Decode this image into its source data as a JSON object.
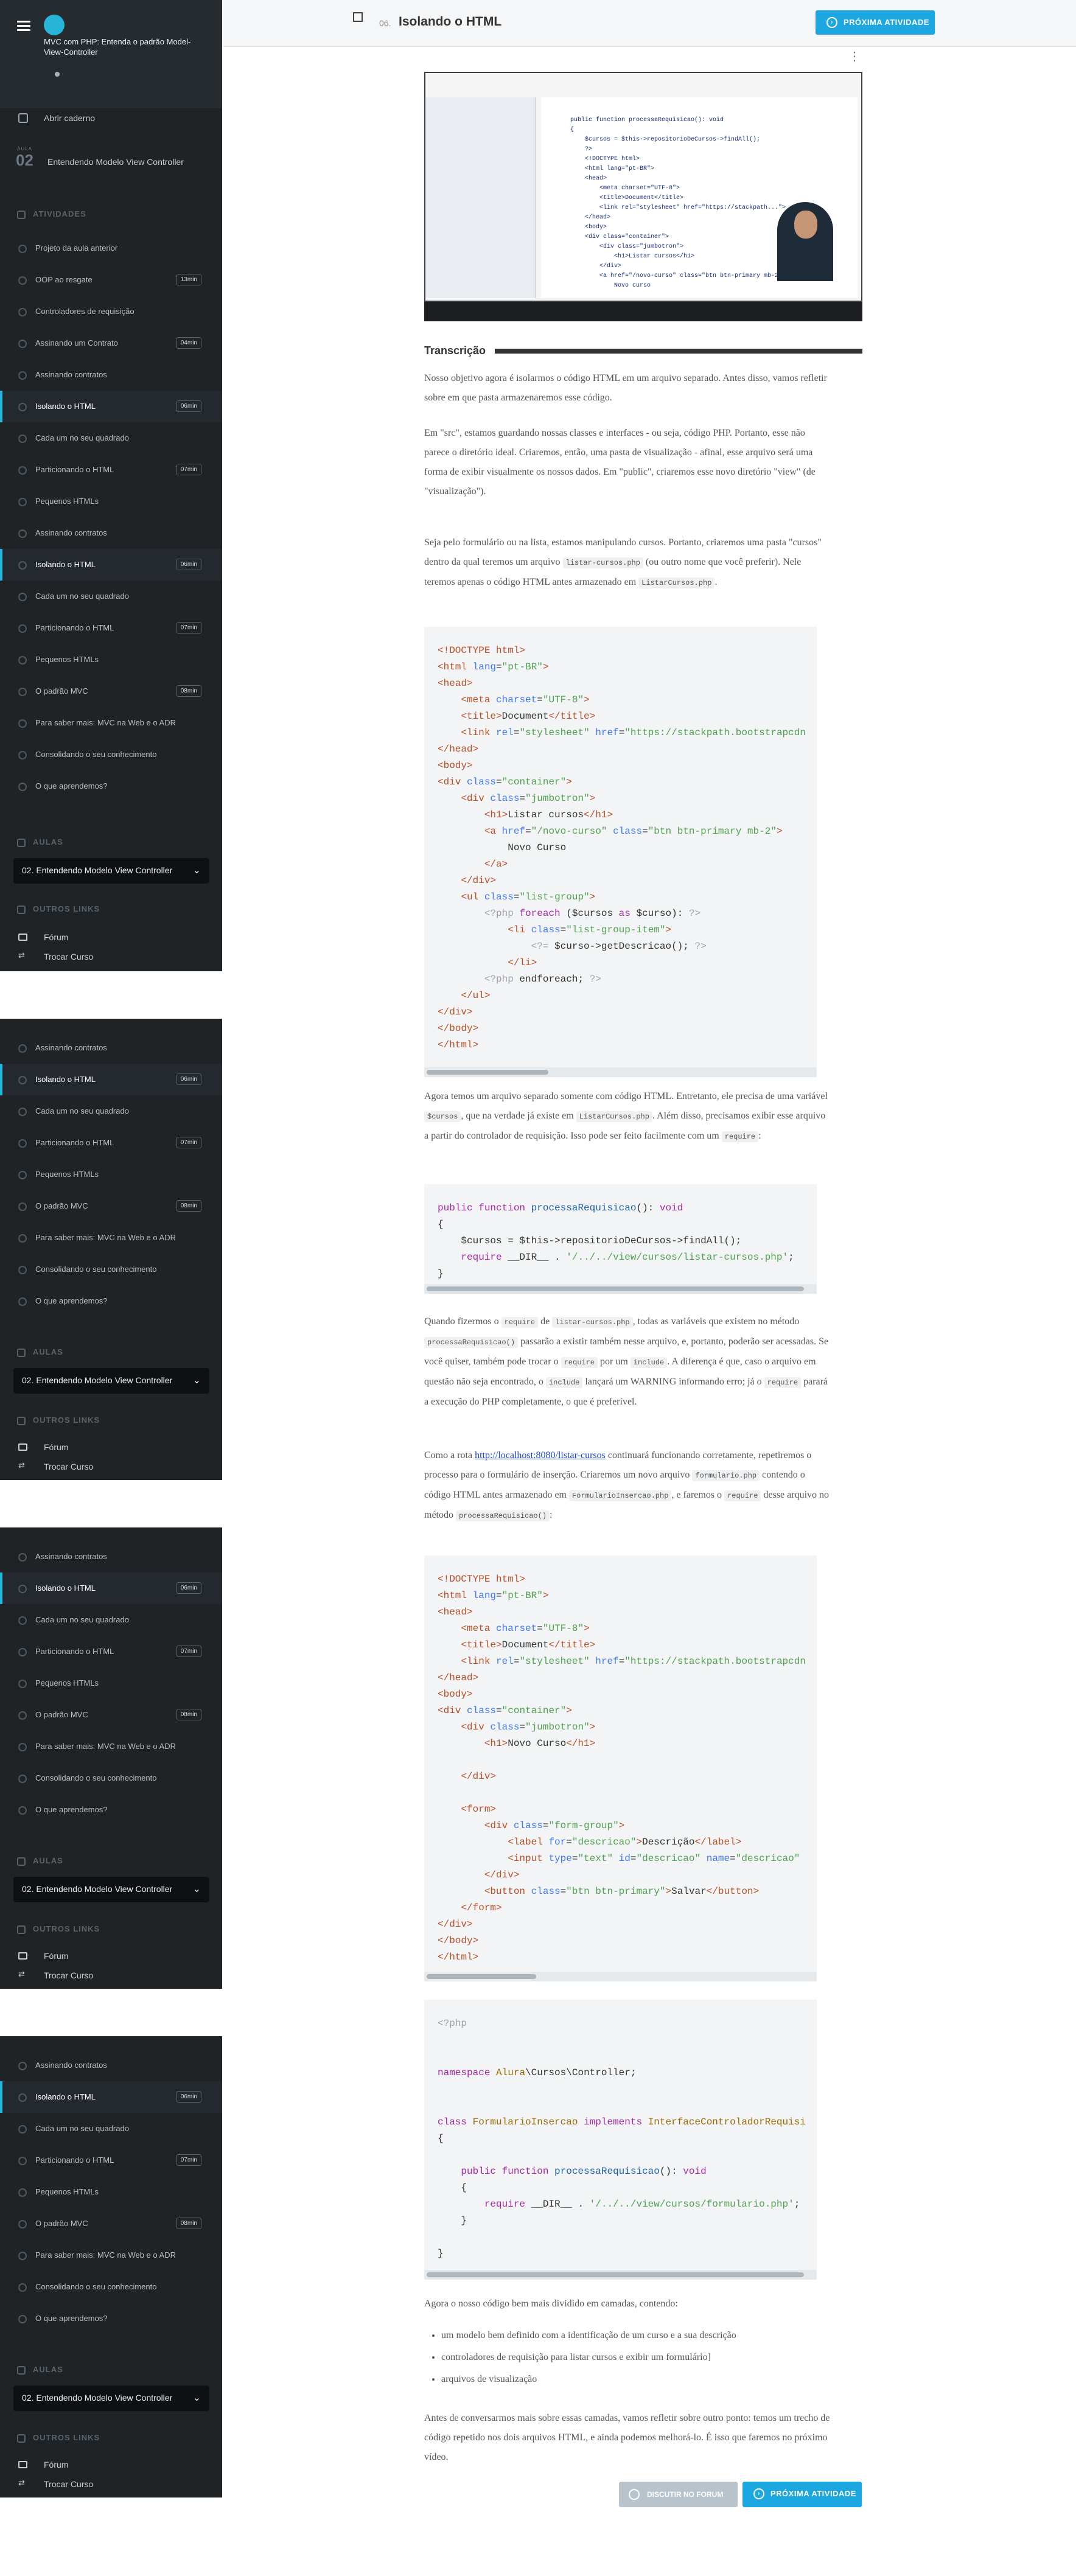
{
  "course": {
    "title": "MVC com PHP: Entenda o padrão Model-View-Controller",
    "open_notebook": "Abrir caderno",
    "aula_label": "AULA",
    "aula_number": "02",
    "aula_title": "Entendendo Modelo View Controller"
  },
  "sidebar": {
    "activities_header": "ATIVIDADES",
    "aulas_header": "AULAS",
    "other_links_header": "OUTROS LINKS",
    "aula_select": "02. Entendendo Modelo View Controller",
    "forum": "Fórum",
    "trocar_curso": "Trocar Curso",
    "activities": [
      {
        "label": "Projeto da aula anterior",
        "duration": ""
      },
      {
        "label": "OOP ao resgate",
        "duration": "13min"
      },
      {
        "label": "Controladores de requisição",
        "duration": ""
      },
      {
        "label": "Assinando um Contrato",
        "duration": "04min"
      },
      {
        "label": "Assinando contratos",
        "duration": ""
      },
      {
        "label": "Isolando o HTML",
        "duration": "06min"
      },
      {
        "label": "Cada um no seu quadrado",
        "duration": ""
      },
      {
        "label": "Particionando o HTML",
        "duration": "07min"
      },
      {
        "label": "Pequenos HTMLs",
        "duration": ""
      },
      {
        "label": "Assinando contratos",
        "duration": ""
      },
      {
        "label": "Isolando o HTML",
        "duration": "06min"
      },
      {
        "label": "Cada um no seu quadrado",
        "duration": ""
      },
      {
        "label": "Particionando o HTML",
        "duration": "07min"
      },
      {
        "label": "Pequenos HTMLs",
        "duration": ""
      },
      {
        "label": "O padrão MVC",
        "duration": "08min"
      },
      {
        "label": "Para saber mais: MVC na Web e o ADR",
        "duration": ""
      },
      {
        "label": "Consolidando o seu conhecimento",
        "duration": ""
      },
      {
        "label": "O que aprendemos?",
        "duration": ""
      }
    ],
    "activities_short": [
      {
        "label": "Assinando contratos",
        "duration": ""
      },
      {
        "label": "Isolando o HTML",
        "duration": "06min"
      },
      {
        "label": "Cada um no seu quadrado",
        "duration": ""
      },
      {
        "label": "Particionando o HTML",
        "duration": "07min"
      },
      {
        "label": "Pequenos HTMLs",
        "duration": ""
      },
      {
        "label": "O padrão MVC",
        "duration": "08min"
      },
      {
        "label": "Para saber mais: MVC na Web e o ADR",
        "duration": ""
      },
      {
        "label": "Consolidando o seu conhecimento",
        "duration": ""
      },
      {
        "label": "O que aprendemos?",
        "duration": ""
      }
    ]
  },
  "topbar": {
    "number": "06.",
    "title": "Isolando o HTML",
    "next_button": "PRÓXIMA ATIVIDADE"
  },
  "transcript": {
    "label": "Transcrição",
    "p1": "Nosso objetivo agora é isolarmos o código HTML em um arquivo separado. Antes disso, vamos refletir sobre em que pasta armazenaremos esse código.",
    "p2": "Em \"src\", estamos guardando nossas classes e interfaces - ou seja, código PHP. Portanto, esse não parece o diretório ideal. Criaremos, então, uma pasta de visualização - afinal, esse arquivo será uma forma de exibir visualmente os nossos dados. Em \"public\", criaremos esse novo diretório \"view\" (de \"visualização\").",
    "p3a": "Seja pelo formulário ou na lista, estamos manipulando cursos. Portanto, criaremos uma pasta \"cursos\" dentro da qual teremos um arquivo ",
    "p3_code1": "listar-cursos.php",
    "p3b": " (ou outro nome que você preferir). Nele teremos apenas o código HTML antes armazenado em ",
    "p3_code2": "ListarCursos.php",
    "p3c": ".",
    "p4a": "Agora temos um arquivo separado somente com código HTML. Entretanto, ele precisa de uma variável ",
    "p4_code1": "$cursos",
    "p4b": ", que na verdade já existe em ",
    "p4_code2": "ListarCursos.php",
    "p4c": ". Além disso, precisamos exibir esse arquivo a partir do controlador de requisição. Isso pode ser feito facilmente com um ",
    "p4_code3": "require",
    "p4d": ":",
    "p5a": "Quando fizermos o ",
    "p5_code1": "require",
    "p5b": " de ",
    "p5_code2": "listar-cursos.php",
    "p5c": ", todas as variáveis que existem no método ",
    "p5_code3": "processaRequisicao()",
    "p5d": " passarão a existir também nesse arquivo, e, portanto, poderão ser acessadas. Se você quiser, também pode trocar o ",
    "p5_code4": "require",
    "p5e": " por um ",
    "p5_code5": "include",
    "p5f": ". A diferença é que, caso o arquivo em questão não seja encontrado, o ",
    "p5_code6": "include",
    "p5g": " lançará um WARNING informando erro; já o ",
    "p5_code7": "require",
    "p5h": " parará a execução do PHP completamente, o que é preferível.",
    "p6a": "Como a rota ",
    "p6_link": "http://localhost:8080/listar-cursos",
    "p6b": " continuará funcionando corretamente, repetiremos o processo para o formulário de inserção. Criaremos um novo arquivo ",
    "p6_code1": "formulario.php",
    "p6c": " contendo o código HTML antes armazenado em ",
    "p6_code2": "FormularioInsercao.php",
    "p6d": ", e faremos o ",
    "p6_code3": "require",
    "p6e": " desse arquivo no método ",
    "p6_code4": "processaRequisicao()",
    "p6f": ":",
    "p7": "Agora o nosso código bem mais dividido em camadas, contendo:",
    "bullets": [
      "um modelo bem definido com a identificação de um curso e a sua descrição",
      "controladores de requisição para listar cursos e exibir um formulário]",
      "arquivos de visualização"
    ],
    "p8": "Antes de conversarmos mais sobre essas camadas, vamos refletir sobre outro ponto: temos um trecho de código repetido nos dois arquivos HTML, e ainda podemos melhorá-lo. É isso que faremos no próximo vídeo."
  },
  "footer": {
    "forum_button": "DISCUTIR NO FORUM",
    "next_button": "PRÓXIMA ATIVIDADE"
  }
}
